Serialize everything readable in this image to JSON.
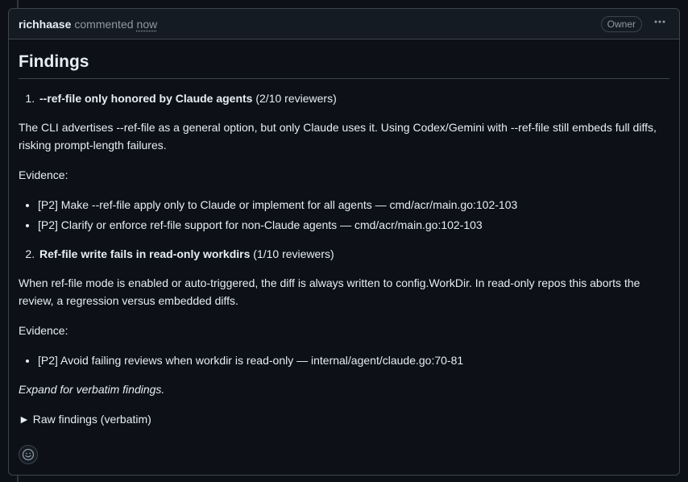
{
  "header": {
    "author": "richhaase",
    "action": "commented",
    "timestamp": "now",
    "badge": "Owner",
    "more_icon": "kebab-horizontal-icon"
  },
  "body": {
    "heading": "Findings",
    "finding1": {
      "number": "1.",
      "title": "--ref-file only honored by Claude agents",
      "count": "(2/10 reviewers)",
      "description": "The CLI advertises --ref-file as a general option, but only Claude uses it. Using Codex/Gemini with --ref-file still embeds full diffs, risking prompt-length failures.",
      "evidence_label": "Evidence:",
      "evidence": [
        "[P2] Make --ref-file apply only to Claude or implement for all agents — cmd/acr/main.go:102-103",
        "[P2] Clarify or enforce ref-file support for non-Claude agents — cmd/acr/main.go:102-103"
      ]
    },
    "finding2": {
      "number": "2.",
      "title": "Ref-file write fails in read-only workdirs",
      "count": "(1/10 reviewers)",
      "description": "When ref-file mode is enabled or auto-triggered, the diff is always written to config.WorkDir. In read-only repos this aborts the review, a regression versus embedded diffs.",
      "evidence_label": "Evidence:",
      "evidence": [
        "[P2] Avoid failing reviews when workdir is read-only — internal/agent/claude.go:70-81"
      ]
    },
    "expand_note": "Expand for verbatim findings.",
    "details_marker": "►",
    "details_summary": "Raw findings (verbatim)"
  },
  "footer": {
    "reaction_icon": "smiley-icon"
  }
}
